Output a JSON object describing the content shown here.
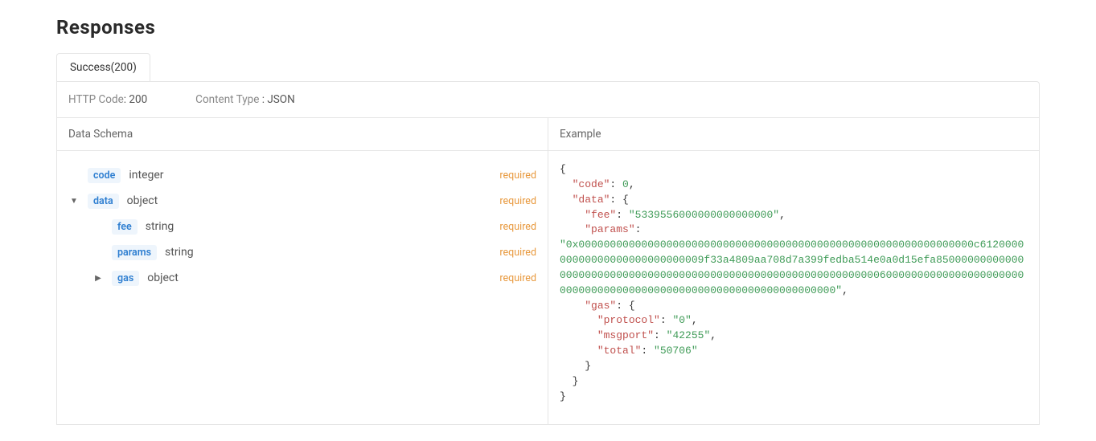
{
  "title": "Responses",
  "tab": {
    "label": "Success(200)"
  },
  "meta": {
    "httpCodeLabel": "HTTP Code",
    "httpCodeValue": ": 200",
    "contentTypeLabel": "Content Type ",
    "contentTypeValue": ": JSON"
  },
  "headers": {
    "schema": "Data Schema",
    "example": "Example"
  },
  "required_label": "required",
  "schema": {
    "code": {
      "name": "code",
      "type": "integer"
    },
    "data": {
      "name": "data",
      "type": "object"
    },
    "fee": {
      "name": "fee",
      "type": "string"
    },
    "params": {
      "name": "params",
      "type": "string"
    },
    "gas": {
      "name": "gas",
      "type": "object"
    }
  },
  "example": {
    "brace_open": "{",
    "brace_close": "}",
    "code_key": "\"code\"",
    "code_val": "0",
    "data_key": "\"data\"",
    "fee_key": "\"fee\"",
    "fee_val": "\"5339556000000000000000\"",
    "params_key": "\"params\"",
    "params_val": "\"0x000000000000000000000000000000000000000000000000000000000000000c612000000000000000000000000009f33a4809aa708d7a399fedba514e0a0d15efa850000000000000000000000000000000000000000000000000000000000000006000000000000000000000000000000000000000000000000000000000000000000\"",
    "gas_key": "\"gas\"",
    "protocol_key": "\"protocol\"",
    "protocol_val": "\"0\"",
    "msgport_key": "\"msgport\"",
    "msgport_val": "\"42255\"",
    "total_key": "\"total\"",
    "total_val": "\"50706\"",
    "colon": ": ",
    "comma": ","
  }
}
